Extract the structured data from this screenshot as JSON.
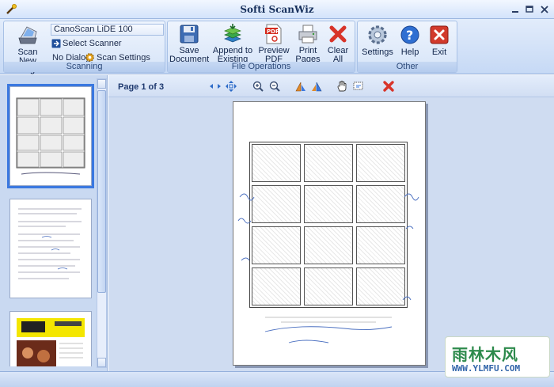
{
  "window": {
    "title": "Softi ScanWiz"
  },
  "ribbon": {
    "scanning": {
      "group_label": "Scanning",
      "scan_new_image": [
        "Scan New",
        "Image"
      ],
      "scanner_name": "CanoScan LiDE 100",
      "select_scanner": "Select Scanner",
      "no_dialog": "No Dialog",
      "scan_settings": "Scan Settings"
    },
    "file_operations": {
      "group_label": "File Operations",
      "save_document": [
        "Save",
        "Document"
      ],
      "append_to_existing_pdf": [
        "Append to",
        "Existing PDF"
      ],
      "preview_pdf": [
        "Preview",
        "PDF"
      ],
      "print_pages": [
        "Print",
        "Pages"
      ],
      "clear_all": [
        "Clear",
        "All"
      ]
    },
    "other": {
      "group_label": "Other",
      "settings": "Settings",
      "help": "Help",
      "exit": "Exit"
    }
  },
  "viewer": {
    "page_indicator": "Page 1 of 3",
    "selected_thumbnail": 1
  },
  "watermark": {
    "main": "雨林木风",
    "sub": "WWW.YLMFU.COM"
  },
  "colors": {
    "accent": "#3a78e0",
    "ribbon_bg": "#c6d9f5",
    "panel_bg": "#c9d9f1",
    "delete_red": "#d8342a"
  },
  "icons": {
    "app": "scanner-wand-icon",
    "scan": "scanner-icon",
    "save": "floppy-icon",
    "append": "stacked-pages-icon",
    "pdf": "pdf-icon",
    "print": "printer-icon",
    "clear": "red-x-icon",
    "settings": "gear-icon",
    "help": "help-icon",
    "exit": "exit-icon"
  }
}
